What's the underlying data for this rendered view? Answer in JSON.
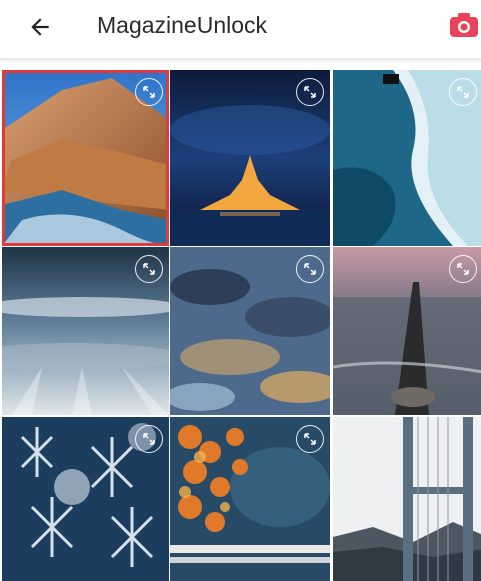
{
  "appbar": {
    "title": "MagazineUnlock",
    "back_icon": "arrow-left-icon",
    "camera_icon": "camera-icon",
    "accent_color": "#e8435a"
  },
  "gallery": {
    "selected_index": 0,
    "selection_color": "#e03a3a",
    "tiles": [
      {
        "subject": "coastal-rocks"
      },
      {
        "subject": "castle-island-night"
      },
      {
        "subject": "surfer-waves"
      },
      {
        "subject": "cloudy-sky-rays"
      },
      {
        "subject": "dusk-clouds"
      },
      {
        "subject": "breakwater-sea"
      },
      {
        "subject": "frost-crystals"
      },
      {
        "subject": "autumn-leaves-water"
      },
      {
        "subject": "suspension-bridge"
      }
    ]
  }
}
